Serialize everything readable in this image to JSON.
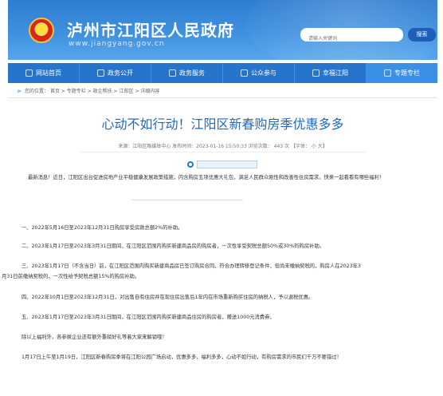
{
  "header": {
    "title": "泸州市江阳区人民政府",
    "url": "www.jiangyang.gov.cn",
    "search_placeholder": "请输入关键词",
    "search_button": "搜索"
  },
  "nav": {
    "items": [
      {
        "label": "网站首页",
        "icon": "home-icon"
      },
      {
        "label": "政务公开",
        "icon": "document-icon"
      },
      {
        "label": "政务服务",
        "icon": "service-icon"
      },
      {
        "label": "公众参与",
        "icon": "chat-icon"
      },
      {
        "label": "幸福江阳",
        "icon": "heart-icon"
      },
      {
        "label": "专题专栏",
        "icon": "folder-icon"
      }
    ]
  },
  "breadcrumb": "您的位置：  首页 > 专题专栏 > 政企帮扶 > 江阳区 > 详细内容",
  "article": {
    "title": "心动不如行动！江阳区新春购房季优惠多多",
    "meta": "来源：江阳区融媒体中心    发布时间：2023-01-16 15:50:33    浏览次数：  443  次    【字体：  小  大】",
    "intro": "最新消息！近日，江阳区出台促进房地产业平稳健康发展政策措施，内含购房五项优惠大礼包，满足人民群众刚性和改善性住房需求。快来一起看看有哪些福利！",
    "paragraphs": {
      "p1": "一、2022年5月16日至2023年12月31日购房享受房款总额2%的补助。",
      "p2": "二、2023年1月17日至2023年3月31日期间，在江阳区范围内购买新建商品房的购房者，一次性享受契税总额50%或30%的购房补助。",
      "p3a": "三、2023年1月17日（不含当日）前，在江阳区范围内购买新建商品房已签订购房合同，符合办理转移登记条件，但尚未缴纳契税的，购房人在2023年3",
      "p3b": "月31日前缴纳契税的，一次性给予契税总额15%的购房补助。",
      "p4": "四、2022年10月1日至2023年12月31日，对出售自有住房并在现住房出售后1年内在市场重新购买住房的纳税人，予以退税优惠。",
      "p5": "五、2023年1月17日至2023年3月31日期间，在江阳区范围内购买新建商品住房的购房者，赠送1000元消费券。",
      "p6": "除以上福利外，各参展企业还有额外重磅好礼等着大家来解锁哦！",
      "p7": "1月17日上午至1月19日，江阳区新春购房季将在江阳公园广场启动，优惠多多，福利多多，心动不如行动，有购房需求的市民们千万不要错过！"
    }
  },
  "colors": {
    "header_blue": "#3e90e0",
    "nav_blue": "#2674cc",
    "title_blue": "#2069c4"
  }
}
